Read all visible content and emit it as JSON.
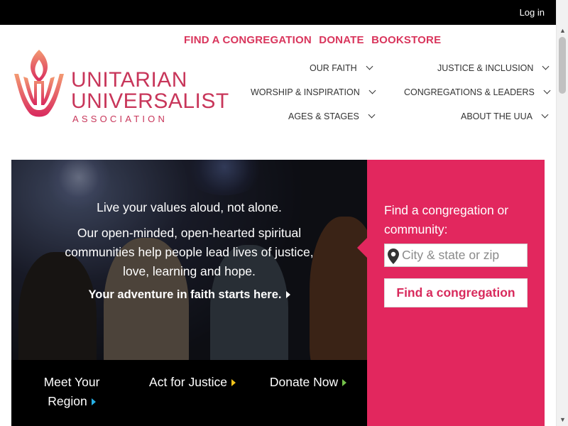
{
  "topbar": {
    "login_label": "Log in"
  },
  "utility_nav": [
    {
      "label": "FIND A CONGREGATION"
    },
    {
      "label": "DONATE"
    },
    {
      "label": "BOOKSTORE"
    }
  ],
  "logo": {
    "line1": "UNITARIAN",
    "line2": "UNIVERSALIST",
    "line3": "ASSOCIATION"
  },
  "main_nav": {
    "our_faith": "OUR FAITH",
    "justice": "JUSTICE & INCLUSION",
    "worship": "WORSHIP & INSPIRATION",
    "congregations": "CONGREGATIONS & LEADERS",
    "ages": "AGES & STAGES",
    "about": "ABOUT THE UUA"
  },
  "hero": {
    "headline": "Live your values aloud, not alone.",
    "body": "Our open-minded, open-hearted spiritual communities help people lead lives of justice, love, learning and hope.",
    "cta": "Your adventure in faith starts here."
  },
  "hero_links": {
    "region": "Meet Your Region",
    "justice": "Act for Justice",
    "donate": "Donate Now"
  },
  "finder": {
    "title": "Find a congregation or community:",
    "placeholder": "City & state or zip",
    "button": "Find a congregation"
  },
  "colors": {
    "brand_pink": "#e2275e",
    "utility_text": "#d9355c",
    "arrow_blue": "#27b1e6",
    "arrow_yellow": "#f3c41a",
    "arrow_green": "#74c24a"
  }
}
